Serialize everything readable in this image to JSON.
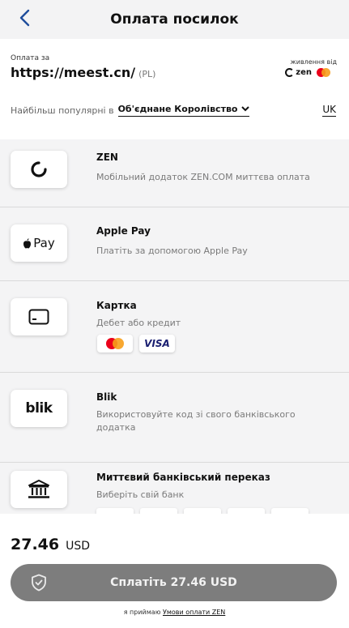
{
  "header": {
    "title": "Оплата посилок"
  },
  "merchant": {
    "label": "Оплата за",
    "url": "https://meest.cn/",
    "country_code": "(PL)",
    "powered_by": "живлення від",
    "brand": "zen"
  },
  "country": {
    "label": "Найбільш популярні в",
    "selected": "Об'єднане Королівство",
    "language": "UK"
  },
  "payment_methods": [
    {
      "name": "ZEN",
      "description": "Мобільний додаток ZEN.COM миттєва оплата",
      "icon": "zen-logo-icon"
    },
    {
      "name": "Apple Pay",
      "description": "Платіть за допомогою Apple Pay",
      "icon_text": "Pay"
    },
    {
      "name": "Картка",
      "description": "Дебет або кредит",
      "badges": [
        "mastercard",
        "VISA"
      ]
    },
    {
      "name": "Blik",
      "description": "Використовуйте код зі свого банківського додатка",
      "icon_text": "blik"
    },
    {
      "name": "Миттєвий банківський переказ",
      "description": "Виберіть свій банк",
      "icon": "bank-icon"
    }
  ],
  "footer": {
    "amount": "27.46",
    "currency": "USD",
    "pay_label": "Сплатіть 27.46 USD",
    "terms_prefix": "я приймаю",
    "terms_link": "Умови оплати ZEN"
  },
  "colors": {
    "pay_button": "#7d7d7d",
    "visa": "#1a1f71",
    "mc_red": "#eb001b",
    "mc_yellow": "#f79e1b",
    "back_arrow": "#1f4d9c"
  }
}
